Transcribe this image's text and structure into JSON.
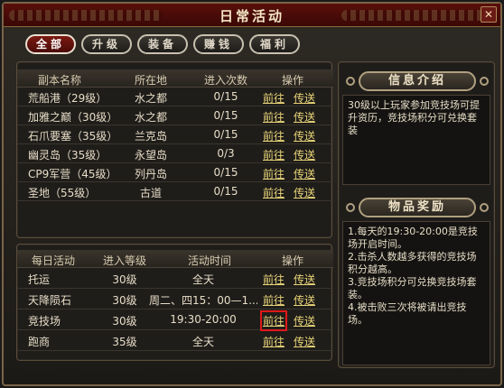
{
  "window": {
    "title": "日常活动",
    "close_label": "✕"
  },
  "tabs": [
    {
      "label": "全部",
      "active": true
    },
    {
      "label": "升级",
      "active": false
    },
    {
      "label": "装备",
      "active": false
    },
    {
      "label": "赚钱",
      "active": false
    },
    {
      "label": "福利",
      "active": false
    }
  ],
  "dungeons": {
    "headers": {
      "name": "副本名称",
      "location": "所在地",
      "count": "进入次数",
      "action": "操作"
    },
    "rows": [
      {
        "name": "荒船港（29级）",
        "location": "水之都",
        "count": "0/15",
        "go": "前往",
        "teleport": "传送"
      },
      {
        "name": "加雅之巅（30级）",
        "location": "水之都",
        "count": "0/15",
        "go": "前往",
        "teleport": "传送"
      },
      {
        "name": "石爪要塞（35级）",
        "location": "兰克岛",
        "count": "0/15",
        "go": "前往",
        "teleport": "传送"
      },
      {
        "name": "幽灵岛（35级）",
        "location": "永望岛",
        "count": "0/3",
        "go": "前往",
        "teleport": "传送"
      },
      {
        "name": "CP9军营（45级）",
        "location": "列丹岛",
        "count": "0/15",
        "go": "前往",
        "teleport": "传送"
      },
      {
        "name": "圣地（55级）",
        "location": "古道",
        "count": "0/15",
        "go": "前往",
        "teleport": "传送"
      }
    ]
  },
  "daily": {
    "headers": {
      "name": "每日活动",
      "level": "进入等级",
      "time": "活动时间",
      "action": "操作"
    },
    "rows": [
      {
        "name": "托运",
        "level": "30级",
        "time": "全天",
        "go": "前往",
        "teleport": "传送"
      },
      {
        "name": "天降陨石",
        "level": "30级",
        "time": "周二、四15：00—1...",
        "go": "前往",
        "teleport": "传送"
      },
      {
        "name": "竞技场",
        "level": "30级",
        "time": "19:30-20:00",
        "go": "前往",
        "teleport": "传送"
      },
      {
        "name": "跑商",
        "level": "35级",
        "time": "全天",
        "go": "前往",
        "teleport": "传送"
      }
    ]
  },
  "info": {
    "header": "信息介绍",
    "text": "30级以上玩家参加竞技场可提升资历，竞技场积分可兑换套装"
  },
  "reward": {
    "header": "物品奖励",
    "lines": [
      "1.每天的19:30-20:00是竞技场开启时间。",
      "2.击杀人数越多获得的竞技场积分越高。",
      "3.竞技场积分可兑换竞技场套装。",
      "4.被击败三次将被请出竞技场。"
    ]
  },
  "colors": {
    "link": "#e8d478",
    "highlight": "#e01818",
    "title_bar": "#5a0f0a"
  }
}
